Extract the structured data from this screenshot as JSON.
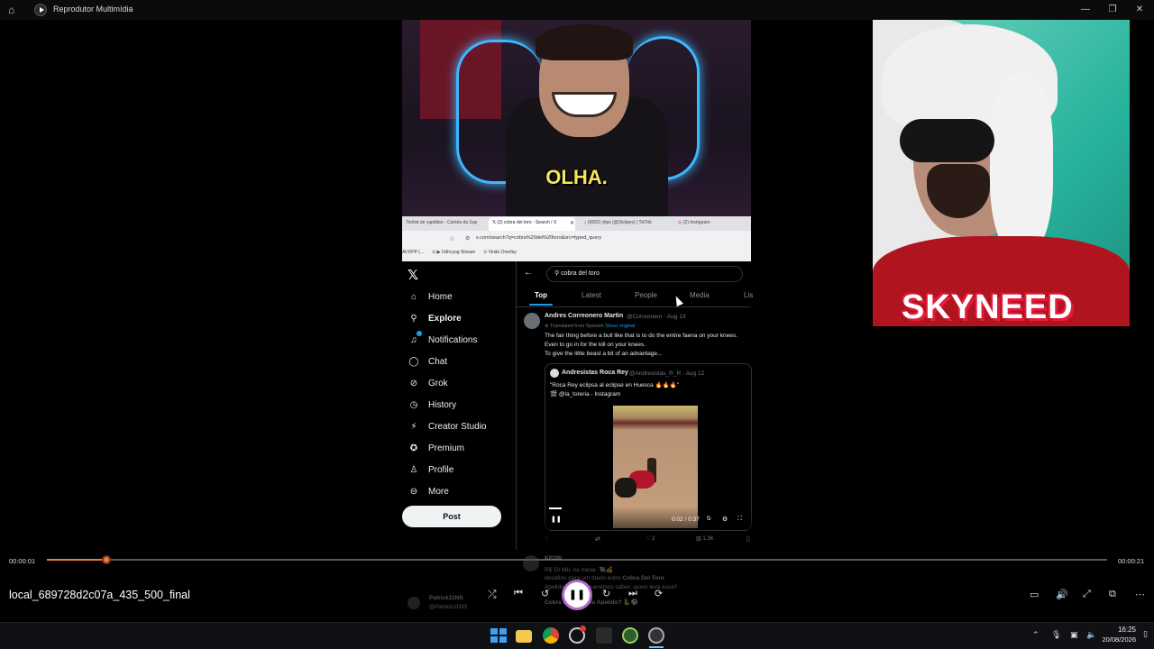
{
  "app": {
    "title": "Reprodutor Multimídia"
  },
  "browser": {
    "tabs": [
      "Tierlist de capitães - Cartola da Sup",
      "(2) cobra del toro - Search / X",
      "(6652) clips (@2tclipes) | TikTok",
      "(2) Instagram"
    ],
    "url": "x.com/search?q=cobra%20del%20toro&src=typed_query",
    "bookmarks": [
      "All KPP (...",
      "Udhcyog Stream",
      "Vinão Overlay"
    ]
  },
  "overlay": {
    "top_caption": "OLHA.",
    "streamer_name": "SKYNEED"
  },
  "x": {
    "search_value": "cobra del toro",
    "nav": [
      "Home",
      "Explore",
      "Notifications",
      "Chat",
      "Grok",
      "History",
      "Creator Studio",
      "Premium",
      "Profile",
      "More"
    ],
    "post_button": "Post",
    "tabs": [
      "Top",
      "Latest",
      "People",
      "Media",
      "Lis"
    ],
    "tweet": {
      "author": "Andres Correonero Martin",
      "handle_date": "@Correonero · Aug 13",
      "translated": "Translated from Spanish",
      "show_original": "Show original",
      "line1": "The fair thing before a bull like that is to do the entire faena on your knees.",
      "line2": "Even to go in for the kill on your knees.",
      "line3": "To give the little beast a bit of an advantage...",
      "quoted_author": "Andresistas Roca Rey",
      "quoted_handle": "@Andresistas_R_R · Aug 12",
      "quoted_text": "\"Roca Rey eclipsa al eclipse en Huesca 🔥🔥🔥\"",
      "quoted_credit": "🎬 @la_toreria - Instagram",
      "video_time": "0:02 / 0:37",
      "likes": "2",
      "views": "1.3K"
    },
    "next_tweet": {
      "author": "KR3W",
      "line1": "R$ 50 MIL na mesa. 💸💰",
      "line2a": "desafiou",
      "line2b": "para um duelo entre",
      "line2c": "Cobra Del Toro",
      "line3": "Apelido... Agora queremos saber: quem leva essa?",
      "line4": "Cobra Del Toro ou Apelido? 🐍⚽"
    },
    "side_user": {
      "name": "Patrick11NS",
      "handle": "@Patrick11NS"
    }
  },
  "player": {
    "elapsed": "00:00:01",
    "remaining": "00:00:21",
    "progress": 0.056,
    "file_name": "local_689728d2c07a_435_500_final"
  },
  "taskbar": {
    "time": "16:25",
    "date": "20/08/2026"
  },
  "colors": {
    "accent": "#f07a3a",
    "x_blue": "#1d9bf0"
  }
}
